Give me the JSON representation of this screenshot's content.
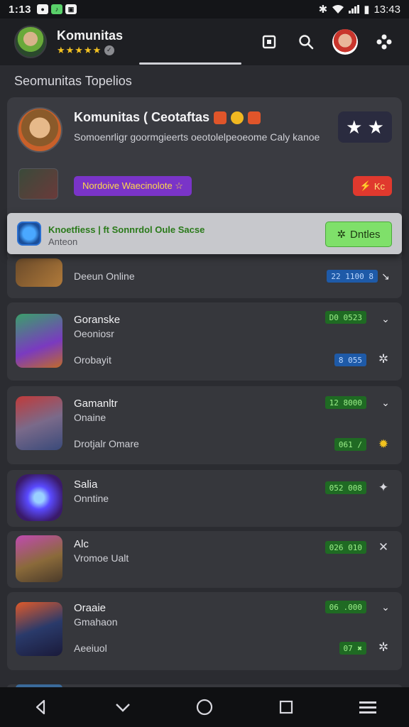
{
  "status_bar": {
    "time": "1:13",
    "icons": [
      "a",
      "b",
      "c"
    ],
    "clock_right": "13:43"
  },
  "app_bar": {
    "title": "Komunitas",
    "stars": "★★★★★",
    "actions": [
      "share-icon",
      "search-icon",
      "profile-avatar",
      "settings-icon"
    ]
  },
  "section": {
    "title": "Seomunitas Topelios"
  },
  "featured": {
    "title": "Komunitas ( Ceotaftas",
    "description": "Somoenrligr goormgieerts oeotolelpeoeome Caly kanoe",
    "pill": "Nordoive Waecinolote ☆",
    "hot_label": "Kc",
    "stars_label": "★ ★"
  },
  "banner": {
    "title": "Knoetfiess | ft Sonnrdol Oule Sacse",
    "subtitle": "Anteon",
    "button": "Dntles"
  },
  "games": [
    {
      "name": "",
      "status": "Deeun Online",
      "extra": "",
      "count": "22 1100 8",
      "count_color": "blue",
      "action": "arrow"
    },
    {
      "name": "Goranske",
      "status": "Oeoniosr",
      "extra": "Orobayit",
      "count": "D0 0523",
      "count_color": "green",
      "second_count": "8 055",
      "action": "settings"
    },
    {
      "name": "Gamanltr",
      "status": "Onaine",
      "extra": "Drotjalr Omare",
      "count": "12 8000",
      "count_color": "green",
      "second_count": "061 /",
      "action": "sun"
    },
    {
      "name": "Salia",
      "status": "Onntine",
      "extra": "",
      "count": "052 008",
      "count_color": "green",
      "action": "star"
    },
    {
      "name": "Alc",
      "status": "Vromoe Ualt",
      "extra": "",
      "count": "026 010",
      "count_color": "green",
      "action": "x"
    },
    {
      "name": "Oraaie",
      "status": "Gmahaon",
      "extra": "Aeeiuol",
      "count": "06 .000",
      "count_color": "green",
      "second_count": "07 ✖",
      "action": "settings"
    }
  ],
  "nav": [
    "back",
    "down",
    "home",
    "recent",
    "menu"
  ]
}
